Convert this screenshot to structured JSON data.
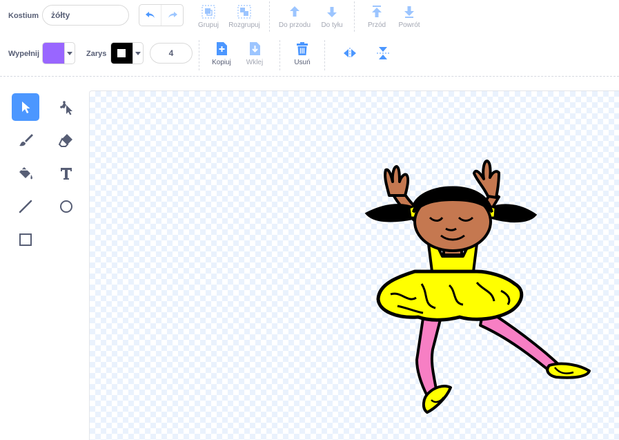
{
  "toolbar": {
    "costume_label": "Kostium",
    "costume_name": "żółty",
    "group": "Grupuj",
    "ungroup": "Rozgrupuj",
    "forward": "Do przodu",
    "backward": "Do tyłu",
    "front": "Przód",
    "back": "Powrót",
    "fill_label": "Wypełnij",
    "outline_label": "Zarys",
    "outline_width": "4",
    "copy": "Kopiuj",
    "paste": "Wklej",
    "delete": "Usuń"
  },
  "colors": {
    "accent": "#4c97ff",
    "fill": "#9966ff",
    "outline": "#000000",
    "text": "#575e75",
    "delete": "#4c97ff"
  },
  "tools": [
    {
      "name": "select-tool",
      "icon": "arrow-icon",
      "active": true
    },
    {
      "name": "reshape-tool",
      "icon": "reshape-icon"
    },
    {
      "name": "brush-tool",
      "icon": "brush-icon"
    },
    {
      "name": "eraser-tool",
      "icon": "eraser-icon"
    },
    {
      "name": "fill-tool",
      "icon": "paint-bucket-icon"
    },
    {
      "name": "text-tool",
      "icon": "text-icon"
    },
    {
      "name": "line-tool",
      "icon": "line-icon"
    },
    {
      "name": "circle-tool",
      "icon": "circle-icon"
    },
    {
      "name": "rectangle-tool",
      "icon": "rectangle-icon"
    }
  ]
}
